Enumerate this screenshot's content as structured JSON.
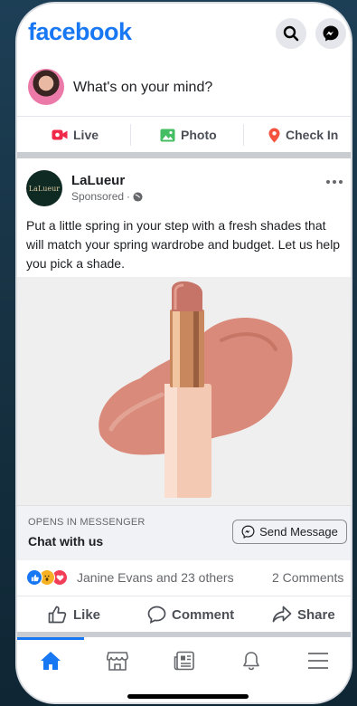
{
  "header": {
    "logo": "facebook"
  },
  "composer": {
    "placeholder": "What's on your mind?"
  },
  "composer_actions": [
    {
      "label": "Live",
      "icon": "live-video-icon",
      "color": "#f02849"
    },
    {
      "label": "Photo",
      "icon": "photo-icon",
      "color": "#45bd62"
    },
    {
      "label": "Check In",
      "icon": "location-pin-icon",
      "color": "#f5533d"
    }
  ],
  "post": {
    "page_logo_text": "LaLueur",
    "page_name": "LaLueur",
    "sponsored": "Sponsored",
    "text": "Put a little spring in your step with a fresh shades that will match your spring wardrobe and budget. Let us help you pick a shade.",
    "cta": {
      "eyebrow": "OPENS IN MESSENGER",
      "title": "Chat with us",
      "button": "Send Message"
    },
    "reactions": {
      "names": "Janine Evans and 23 others",
      "comments": "2 Comments"
    },
    "actions": {
      "like": "Like",
      "comment": "Comment",
      "share": "Share"
    }
  },
  "tabbar": {
    "active": "home",
    "items": [
      "home-icon",
      "marketplace-icon",
      "news-icon",
      "notifications-bell-icon",
      "menu-icon"
    ]
  },
  "colors": {
    "brand": "#1877f2",
    "lipstick": "#d98a7a",
    "case": "#f4c9b4"
  }
}
